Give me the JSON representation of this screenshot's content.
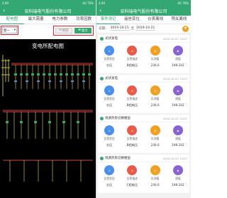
{
  "left": {
    "status": {
      "time": "2:40",
      "right": "4G 76%"
    },
    "title": "安科瑞电气股份有限公司",
    "tabs": [
      "配电图",
      "最大需量",
      "电力参数",
      "功率因数"
    ],
    "select_value": "图一",
    "btn_reset": "刷新",
    "btn_enlarge": "放大",
    "diagram_title": "变电所配电图"
  },
  "right": {
    "status": {
      "time": "2:40",
      "right": "4G 76%"
    },
    "title": "安科瑞电气股份有限公司",
    "tabs": [
      "事件测记",
      "遥信变位",
      "仪表离线",
      "预关离线"
    ],
    "search": {
      "label": "日期：",
      "start": "2019-10-21",
      "to": "至",
      "end": "2019-10-21"
    },
    "cards": [
      {
        "name": "光伏发电",
        "time": "2019-10-21 13:07",
        "items": [
          {
            "label": "告警类型",
            "value": "欠压",
            "color": "#4a8fe8"
          },
          {
            "label": "告警描述",
            "value": "B相电压",
            "color": "#e85a4a"
          },
          {
            "label": "实测值",
            "value": "236.6",
            "color": "#f0a020"
          },
          {
            "label": "阈值",
            "value": "198-242",
            "color": "#8a63d2"
          }
        ]
      },
      {
        "name": "光伏发电",
        "time": "2019-10-21 13:07",
        "items": [
          {
            "label": "告警类型",
            "value": "欠压",
            "color": "#4a8fe8"
          },
          {
            "label": "告警描述",
            "value": "B相电压",
            "color": "#e85a4a"
          },
          {
            "label": "实测值",
            "value": "236.6",
            "color": "#f0a020"
          },
          {
            "label": "阈值",
            "value": "198-242",
            "color": "#8a63d2"
          }
        ]
      },
      {
        "name": "地源热泵切换楼层",
        "time": "2019-10-21 13:07",
        "items": [
          {
            "label": "告警类型",
            "value": "欠压",
            "color": "#4a8fe8"
          },
          {
            "label": "告警描述",
            "value": "B相电压",
            "color": "#e85a4a"
          },
          {
            "label": "实测值",
            "value": "236.6",
            "color": "#f0a020"
          },
          {
            "label": "阈值",
            "value": "198-242",
            "color": "#8a63d2"
          }
        ]
      },
      {
        "name": "地源热泵切换楼层",
        "time": "2019-10-21 13:07",
        "items": [
          {
            "label": "告警类型",
            "value": "欠压",
            "color": "#4a8fe8"
          },
          {
            "label": "告警描述",
            "value": "C相电压",
            "color": "#e85a4a"
          },
          {
            "label": "实测值",
            "value": "236.6",
            "color": "#f0a020"
          },
          {
            "label": "阈值",
            "value": "198-242",
            "color": "#8a63d2"
          }
        ]
      }
    ]
  }
}
